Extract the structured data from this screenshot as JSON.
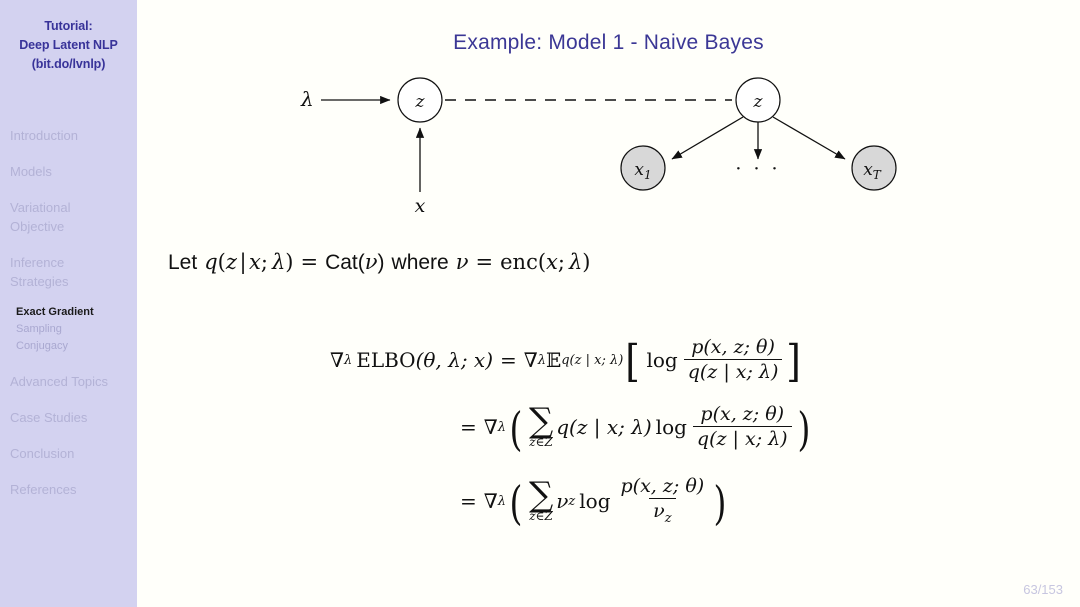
{
  "slide": {
    "title": "Example: Model 1 - Naive Bayes",
    "page_number": "63/153",
    "background_color": "#fffffa",
    "title_color": "#3b3795"
  },
  "sidebar": {
    "background_color": "#d3d2f0",
    "brand": {
      "line1": "Tutorial:",
      "line2": "Deep Latent NLP",
      "line3": "(bit.do/lvnlp)",
      "color": "#383399"
    },
    "items": [
      {
        "label": "Introduction",
        "level": 1,
        "active": false
      },
      {
        "label": "Models",
        "level": 1,
        "active": false
      },
      {
        "label": "Variational Objective",
        "level": 1,
        "active": false
      },
      {
        "label": "Inference Strategies",
        "level": 1,
        "active": false
      },
      {
        "label": "Exact Gradient",
        "level": 2,
        "active": true
      },
      {
        "label": "Sampling",
        "level": 2,
        "active": false
      },
      {
        "label": "Conjugacy",
        "level": 2,
        "active": false
      },
      {
        "label": "Advanced Topics",
        "level": 1,
        "active": false
      },
      {
        "label": "Case Studies",
        "level": 1,
        "active": false
      },
      {
        "label": "Conclusion",
        "level": 1,
        "active": false
      },
      {
        "label": "References",
        "level": 1,
        "active": false
      }
    ],
    "inactive_color": "#b3b2d6",
    "active_color": "#1a1a1a"
  },
  "diagram": {
    "type": "probabilistic-graphical-model",
    "nodes": [
      {
        "id": "z_left",
        "label": "z",
        "shape": "circle",
        "fill": "#ffffff",
        "observed": false
      },
      {
        "id": "z_right",
        "label": "z",
        "shape": "circle",
        "fill": "#ffffff",
        "observed": false
      },
      {
        "id": "x1",
        "label": "x₁",
        "shape": "circle",
        "fill": "#d8d8d8",
        "observed": true
      },
      {
        "id": "xT",
        "label": "x_T",
        "shape": "circle",
        "fill": "#d8d8d8",
        "observed": true
      }
    ],
    "free_labels": [
      {
        "id": "lambda",
        "label": "λ"
      },
      {
        "id": "x_input",
        "label": "x"
      },
      {
        "id": "ellipsis",
        "label": "..."
      }
    ],
    "edges": [
      {
        "from": "lambda",
        "to": "z_left",
        "style": "solid-arrow"
      },
      {
        "from": "x_input",
        "to": "z_left",
        "style": "solid-arrow"
      },
      {
        "from": "z_left",
        "to": "z_right",
        "style": "dashed"
      },
      {
        "from": "z_right",
        "to": "x1",
        "style": "solid-arrow"
      },
      {
        "from": "z_right",
        "to": "ellipsis",
        "style": "solid-arrow"
      },
      {
        "from": "z_right",
        "to": "xT",
        "style": "solid-arrow"
      }
    ]
  },
  "let_line": {
    "let": "Let",
    "q": "q",
    "open": "(",
    "z": "z",
    "mid": "|",
    "x": "x",
    "semi": ";",
    "lambda": "λ",
    "close": ")",
    "eq": "=",
    "cat": "Cat",
    "nu": "ν",
    "where": "where",
    "enc": "enc"
  },
  "equations": [
    {
      "id": "eq1",
      "lhs_nabla": "∇",
      "lhs_sub": "λ",
      "elbo": "ELBO",
      "elbo_args": "(θ, λ; x)",
      "eq": "=",
      "rhs_nabla": "∇",
      "rhs_sub": "λ",
      "expectation": "𝔼",
      "expectation_sub": "q(z | x; λ)",
      "bracket_open": "[",
      "log": "log",
      "frac_num": "p(x, z; θ)",
      "frac_den": "q(z | x; λ)",
      "bracket_close": "]"
    },
    {
      "id": "eq2",
      "eq": "=",
      "nabla": "∇",
      "nabla_sub": "λ",
      "paren_open": "(",
      "sum": "∑",
      "sum_sub": "z∈Z",
      "term": "q(z | x; λ)",
      "log": "log",
      "frac_num": "p(x, z; θ)",
      "frac_den": "q(z | x; λ)",
      "paren_close": ")"
    },
    {
      "id": "eq3",
      "eq": "=",
      "nabla": "∇",
      "nabla_sub": "λ",
      "paren_open": "(",
      "sum": "∑",
      "sum_sub": "z∈Z",
      "term": "ν",
      "term_sub": "z",
      "log": "log",
      "frac_num": "p(x, z; θ)",
      "frac_den": "ν",
      "frac_den_sub": "z",
      "paren_close": ")"
    }
  ]
}
